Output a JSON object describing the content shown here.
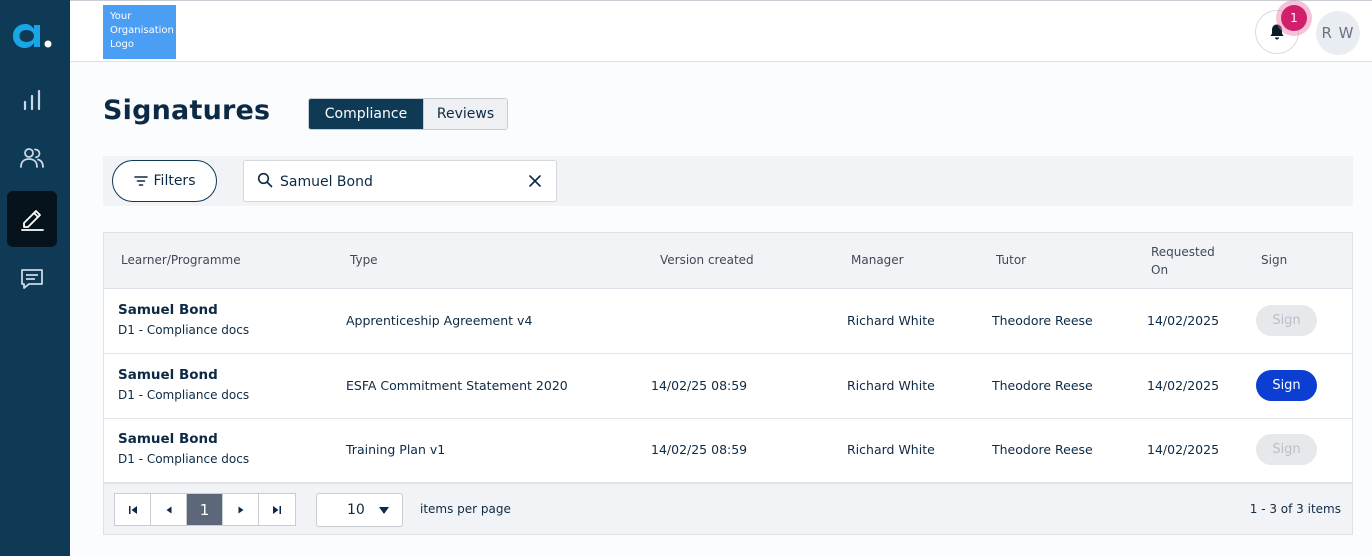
{
  "org_logo": {
    "text": "Your Organisation Logo"
  },
  "header": {
    "notification_count": "1",
    "avatar_initials": "R W"
  },
  "sidebar": {
    "items": [
      {
        "name": "dashboard",
        "icon": "bar-chart-icon"
      },
      {
        "name": "learners",
        "icon": "users-icon"
      },
      {
        "name": "signatures",
        "icon": "pen-signature-icon",
        "active": true
      },
      {
        "name": "messages",
        "icon": "chat-icon"
      }
    ]
  },
  "page": {
    "title": "Signatures",
    "tabs": [
      {
        "label": "Compliance",
        "active": true
      },
      {
        "label": "Reviews",
        "active": false
      }
    ]
  },
  "filters": {
    "button_label": "Filters",
    "search_value": "Samuel Bond"
  },
  "table": {
    "headers": {
      "learner": "Learner/Programme",
      "type": "Type",
      "version": "Version created",
      "manager": "Manager",
      "tutor": "Tutor",
      "requested": "Requested On",
      "sign": "Sign"
    },
    "rows": [
      {
        "learner": "Samuel Bond",
        "programme": "D1 - Compliance docs",
        "type": "Apprenticeship Agreement v4",
        "version": "",
        "manager": "Richard White",
        "tutor": "Theodore Reese",
        "requested": "14/02/2025",
        "sign_label": "Sign",
        "sign_enabled": false
      },
      {
        "learner": "Samuel Bond",
        "programme": "D1 - Compliance docs",
        "type": "ESFA Commitment Statement 2020",
        "version": "14/02/25 08:59",
        "manager": "Richard White",
        "tutor": "Theodore Reese",
        "requested": "14/02/2025",
        "sign_label": "Sign",
        "sign_enabled": true
      },
      {
        "learner": "Samuel Bond",
        "programme": "D1 - Compliance docs",
        "type": "Training Plan v1",
        "version": "14/02/25 08:59",
        "manager": "Richard White",
        "tutor": "Theodore Reese",
        "requested": "14/02/2025",
        "sign_label": "Sign",
        "sign_enabled": false
      }
    ]
  },
  "pager": {
    "current_page": "1",
    "page_size": "10",
    "per_page_label": "items per page",
    "info": "1 - 3 of 3 items"
  },
  "colors": {
    "sidebar": "#0f3a56",
    "accent": "#0b3ed1",
    "badge": "#cf1f6d",
    "logo_bg": "#4a9ef3"
  }
}
